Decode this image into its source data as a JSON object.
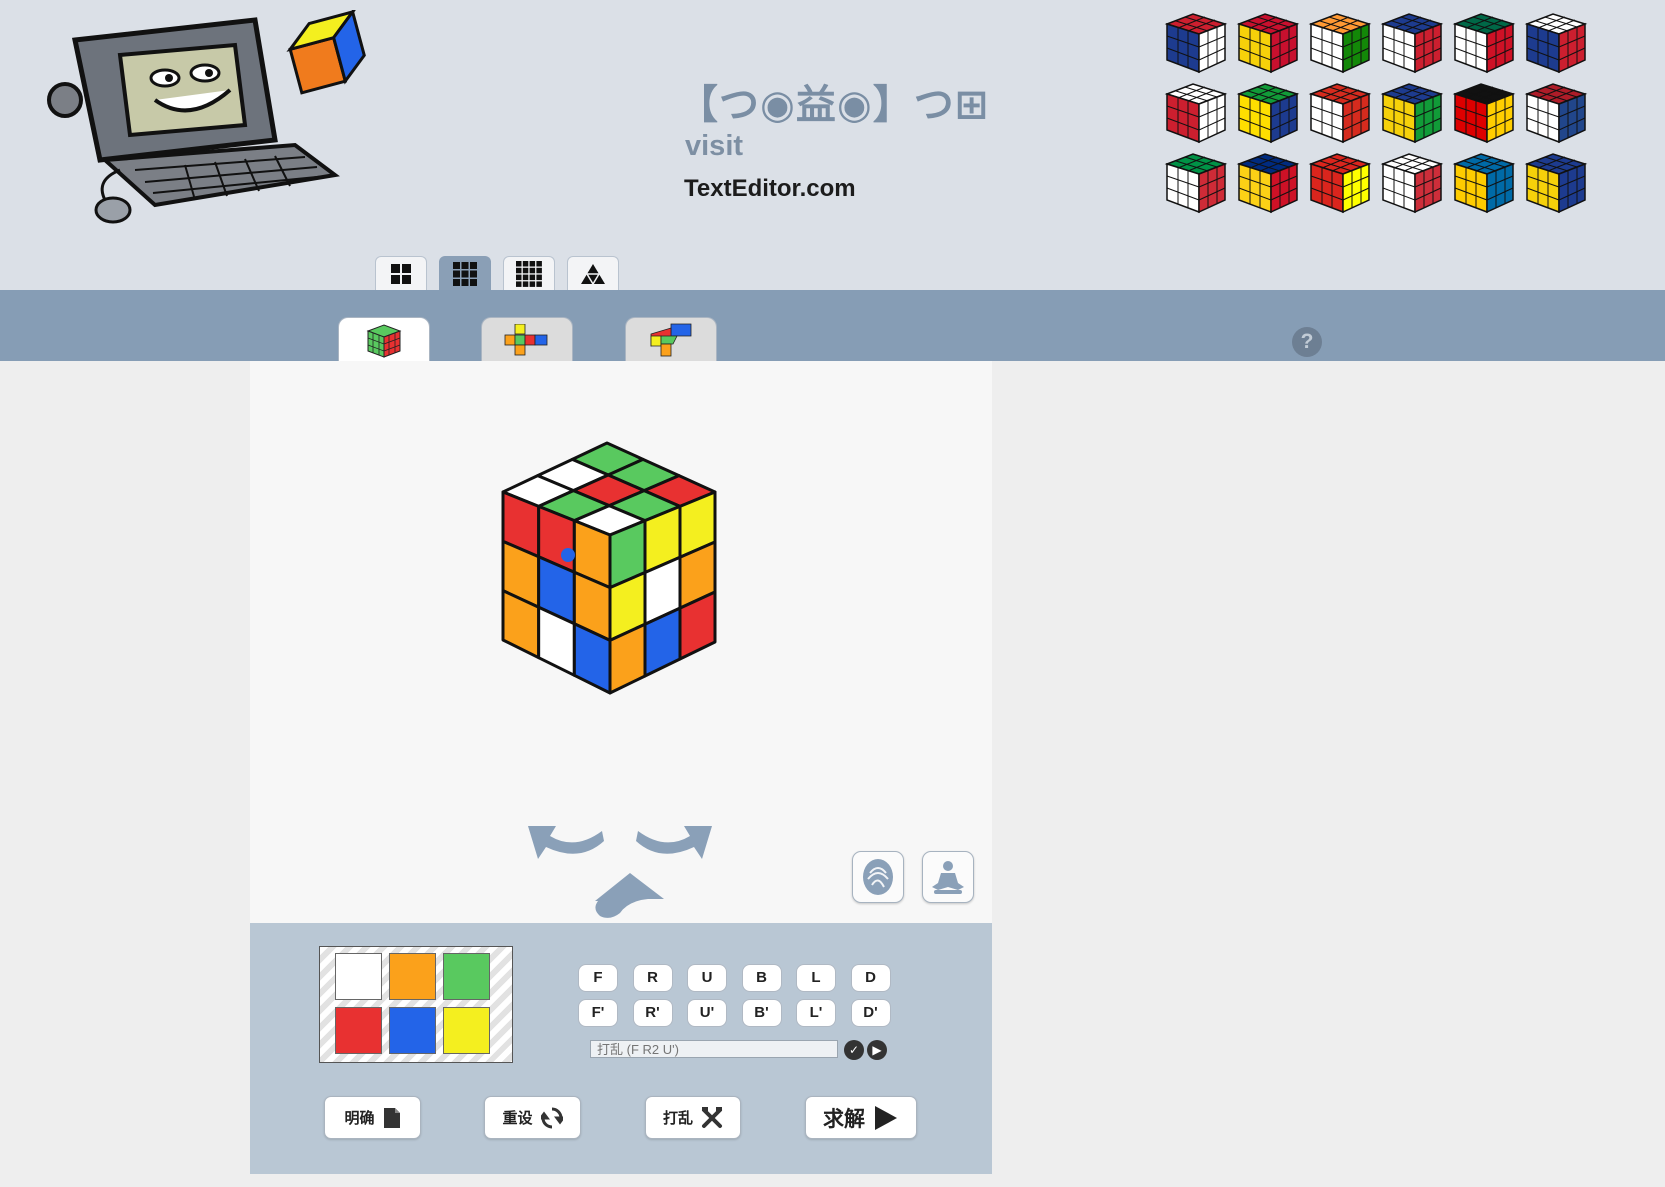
{
  "header": {
    "emoticon": "【つ◉益◉】つ⊞",
    "visit_text": "visit",
    "site_text": "TextEditor.com",
    "mascot_icon": "computer-mascot-holding-cube-icon",
    "flag_cubes": [
      {
        "name": "uk-flag-cube"
      },
      {
        "name": "spain-flag-cube"
      },
      {
        "name": "india-flag-cube"
      },
      {
        "name": "france-flag-cube"
      },
      {
        "name": "mexico-flag-cube"
      },
      {
        "name": "russia-flag-cube"
      },
      {
        "name": "england-flag-cube"
      },
      {
        "name": "brazil-flag-cube"
      },
      {
        "name": "canada-flag-cube"
      },
      {
        "name": "ukraine-flag-cube"
      },
      {
        "name": "germany-flag-cube"
      },
      {
        "name": "netherlands-flag-cube"
      },
      {
        "name": "italy-flag-cube"
      },
      {
        "name": "romania-flag-cube"
      },
      {
        "name": "vietnam-flag-cube"
      },
      {
        "name": "korea-flag-cube"
      },
      {
        "name": "sweden-flag-cube"
      },
      {
        "name": "blue-yellow-flag-cube"
      }
    ]
  },
  "size_tabs": [
    {
      "name": "2x2-cube-tab",
      "icon": "grid-2x2-icon",
      "active": false
    },
    {
      "name": "3x3-cube-tab",
      "icon": "grid-3x3-icon",
      "active": true
    },
    {
      "name": "4x4-cube-tab",
      "icon": "grid-4x4-icon",
      "active": false
    },
    {
      "name": "pyraminx-tab",
      "icon": "pyramid-icon",
      "active": false
    }
  ],
  "view_tabs": [
    {
      "name": "3d-view-tab",
      "icon": "cube-3d-icon",
      "active": true
    },
    {
      "name": "net-view-tab",
      "icon": "cube-net-icon",
      "active": false
    },
    {
      "name": "half-net-view-tab",
      "icon": "cube-half-net-icon",
      "active": false
    }
  ],
  "help": {
    "label": "?"
  },
  "colors": {
    "white": "#ffffff",
    "orange": "#fba11b",
    "green": "#59c95f",
    "red": "#e83131",
    "blue": "#2364e8",
    "yellow": "#f4ef1f",
    "accent": "#869db5",
    "panel": "#b9c7d4"
  },
  "cube_faces": {
    "top": [
      [
        "green",
        "green",
        "red"
      ],
      [
        "white",
        "red",
        "green"
      ],
      [
        "white",
        "green",
        "white"
      ]
    ],
    "front": [
      [
        "red",
        "red",
        "orange"
      ],
      [
        "orange",
        "blue",
        "orange"
      ],
      [
        "orange",
        "white",
        "blue"
      ]
    ],
    "right": [
      [
        "green",
        "yellow",
        "yellow"
      ],
      [
        "yellow",
        "white",
        "orange"
      ],
      [
        "orange",
        "blue",
        "red"
      ]
    ]
  },
  "palette": [
    "white",
    "orange",
    "green",
    "red",
    "blue",
    "yellow"
  ],
  "moves": {
    "row1": [
      "F",
      "R",
      "U",
      "B",
      "L",
      "D"
    ],
    "row2": [
      "F'",
      "R'",
      "U'",
      "B'",
      "L'",
      "D'"
    ]
  },
  "scramble": {
    "placeholder": "打乱 (F R2 U')",
    "value": ""
  },
  "actions": {
    "clear": {
      "label": "明确",
      "icon": "document-icon"
    },
    "reset": {
      "label": "重设",
      "icon": "refresh-icon"
    },
    "scramble": {
      "label": "打乱",
      "icon": "shuffle-icon"
    },
    "solve": {
      "label": "求解",
      "icon": "play-icon"
    }
  }
}
